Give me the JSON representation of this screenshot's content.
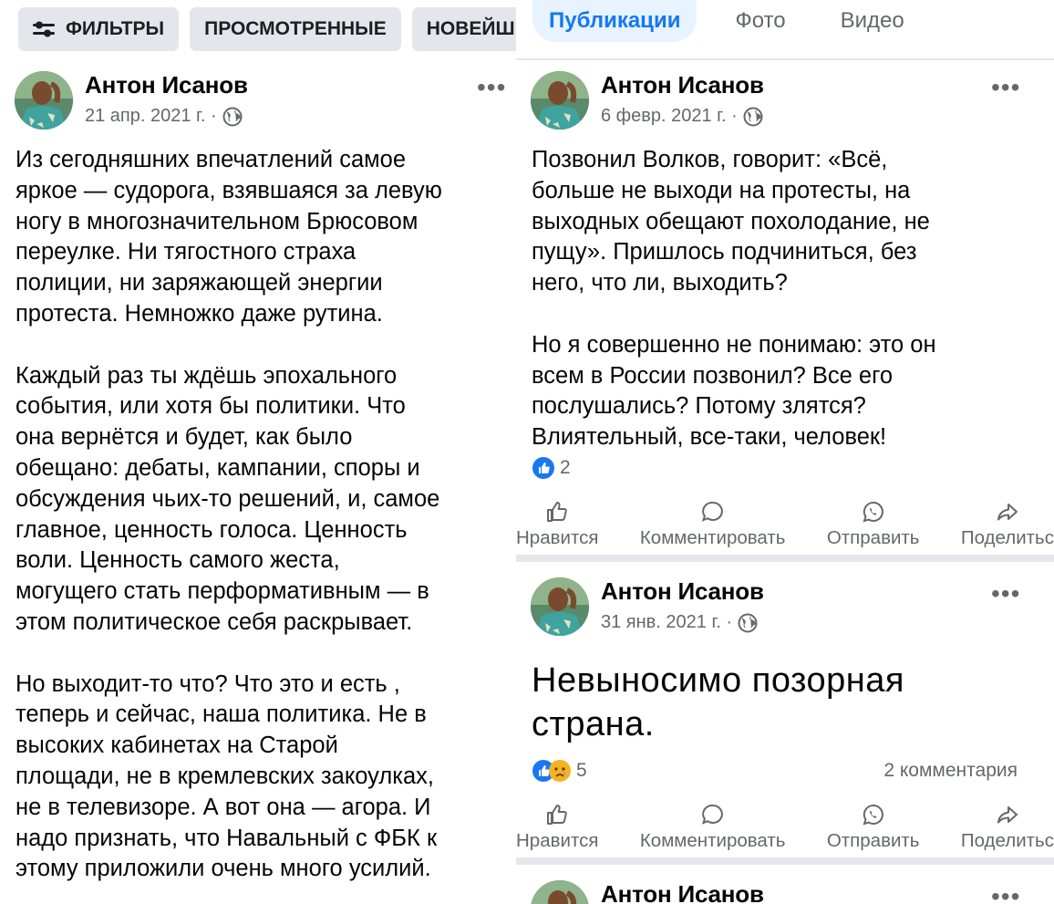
{
  "left": {
    "chips": [
      {
        "label": "ФИЛЬТРЫ",
        "icon": "filter-icon"
      },
      {
        "label": "ПРОСМОТРЕННЫЕ"
      },
      {
        "label": "НОВЕЙШЕЕ"
      }
    ],
    "post": {
      "author": "Антон Исанов",
      "date": "21 апр. 2021 г. ·",
      "privacy_icon": "globe-icon",
      "more": "•••",
      "text": "Из сегодняшних впечатлений самое\nяркое — судорога, взявшаяся за левую\nногу в многозначительном Брюсовом\nпереулке. Ни тягостного страха\nполиции, ни заряжающей энергии\nпротеста. Немножко даже рутина.\n\nКаждый раз ты ждёшь эпохального\nсобытия, или хотя бы политики. Что\nона вернётся и будет, как было\nобещано: дебаты, кампании, споры и\nобсуждения чьих-то решений, и, самое\nглавное, ценность голоса. Ценность\nволи. Ценность самого жеста,\nмогущего стать перформативным — в\nэтом политическое себя раскрывает.\n\nНо выходит-то что? Что это и есть ,\nтеперь и сейчас, наша политика. Не в\nвысоких кабинетах на Старой\nплощади, не в кремлевских закоулках,\nне в телевизоре. А вот она — агора. И\nнадо признать, что Навальный с ФБК к\nэтому приложили очень много усилий."
    }
  },
  "right": {
    "tabs": [
      {
        "label": "Публикации",
        "active": true
      },
      {
        "label": "Фото",
        "active": false
      },
      {
        "label": "Видео",
        "active": false
      }
    ],
    "actions": {
      "like": "Нравится",
      "comment": "Комментировать",
      "send": "Отправить",
      "share": "Поделитьс"
    },
    "posts": [
      {
        "author": "Антон Исанов",
        "date": "6 февр. 2021 г. ·",
        "more": "•••",
        "text": "Позвонил Волков, говорит: «Всё,\nбольше не выходи на протесты, на\nвыходных обещают похолодание, не\nпущу». Пришлось подчиниться, без\nнего, что ли, выходить?\n\nНо я совершенно не понимаю: это он\nвсем в России позвонил? Все его\nпослушались? Потому злятся?\nВлиятельный, все-таки, человек!",
        "reactions": "2"
      },
      {
        "author": "Антон Исанов",
        "date": "31 янв. 2021 г. ·",
        "more": "•••",
        "text": "Невыносимо позорная\nстрана.",
        "reactions": "5",
        "comments": "2 комментария"
      },
      {
        "author": "Антон Исанов",
        "more": "•••"
      }
    ]
  },
  "colors": {
    "accent": "#1877f2",
    "tab_bg": "#e7f3ff",
    "chip_bg": "#e4e6eb",
    "muted": "#65676b"
  }
}
